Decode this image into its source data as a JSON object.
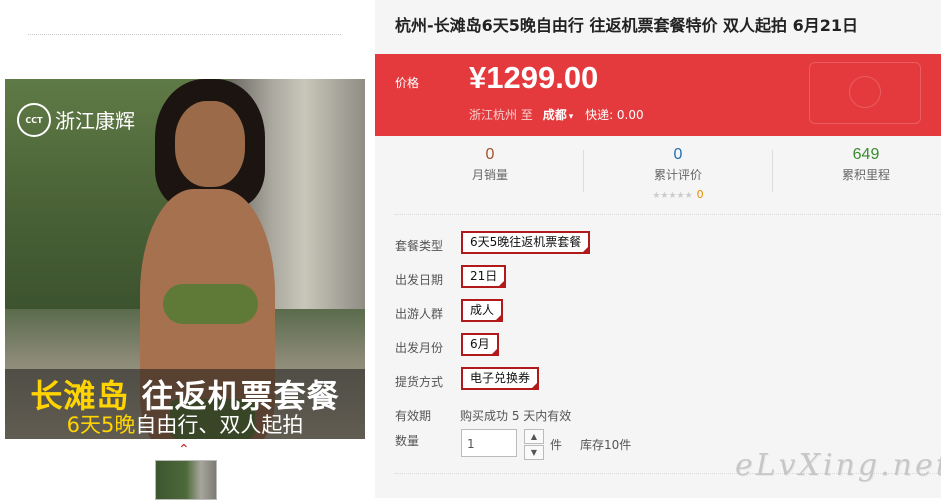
{
  "gallery": {
    "brand_logo_mark": "CCT",
    "brand_name": "浙江康辉",
    "promo_line1_part1": "长滩岛",
    "promo_line1_part2": " 往返机票套餐",
    "promo_line2_part1": "6天5晚",
    "promo_line2_part2": "自由行、双人起拍",
    "chevron": "⌃"
  },
  "product": {
    "title": "杭州-长滩岛6天5晚自由行 往返机票套餐特价 双人起拍 6月21日"
  },
  "price": {
    "label": "价格",
    "value": "¥1299.00",
    "origin": "浙江杭州",
    "to_label": "至",
    "destination": "成都",
    "caret": "▾",
    "shipping": "快递: 0.00"
  },
  "stats": {
    "monthly_sales": {
      "value": "0",
      "label": "月销量",
      "color": "#a0522d"
    },
    "reviews": {
      "value": "0",
      "label": "累计评价",
      "color": "#1f6fb5",
      "stars": "★★★★★",
      "star_count": "0"
    },
    "points": {
      "value": "649",
      "label": "累积里程",
      "color": "#3a8a2e"
    }
  },
  "options": [
    {
      "label": "套餐类型",
      "value": "6天5晚往返机票套餐"
    },
    {
      "label": "出发日期",
      "value": "21日"
    },
    {
      "label": "出游人群",
      "value": "成人"
    },
    {
      "label": "出发月份",
      "value": "6月"
    },
    {
      "label": "提货方式",
      "value": "电子兑换券"
    }
  ],
  "validity": {
    "label": "有效期",
    "value": "购买成功 5 天内有效"
  },
  "quantity": {
    "label": "数量",
    "value": "1",
    "up": "▲",
    "down": "▼",
    "unit": "件",
    "stock": "库存10件"
  },
  "watermark": "eLvXing.net",
  "colors": {
    "accent_red": "#e43a3d",
    "chip_border": "#b1191a"
  }
}
